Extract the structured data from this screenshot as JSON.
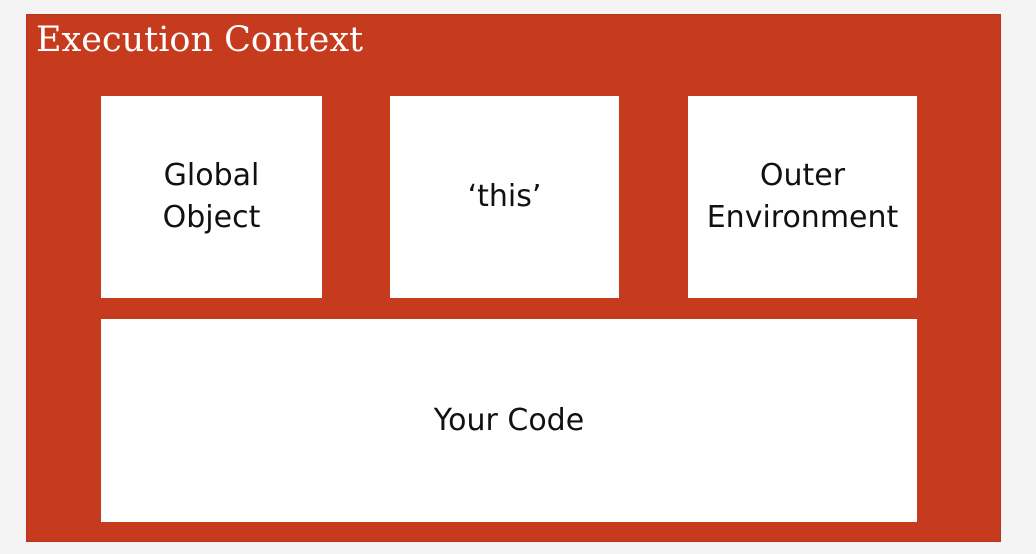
{
  "diagram": {
    "title": "Execution Context",
    "boxes": {
      "global_object": "Global\nObject",
      "this": "‘this’",
      "outer_environment": "Outer\nEnvironment",
      "your_code": "Your Code"
    }
  },
  "colors": {
    "frame_background": "#c63a1e",
    "box_background": "#ffffff",
    "title_text": "#ffffff",
    "box_text": "#111111"
  }
}
